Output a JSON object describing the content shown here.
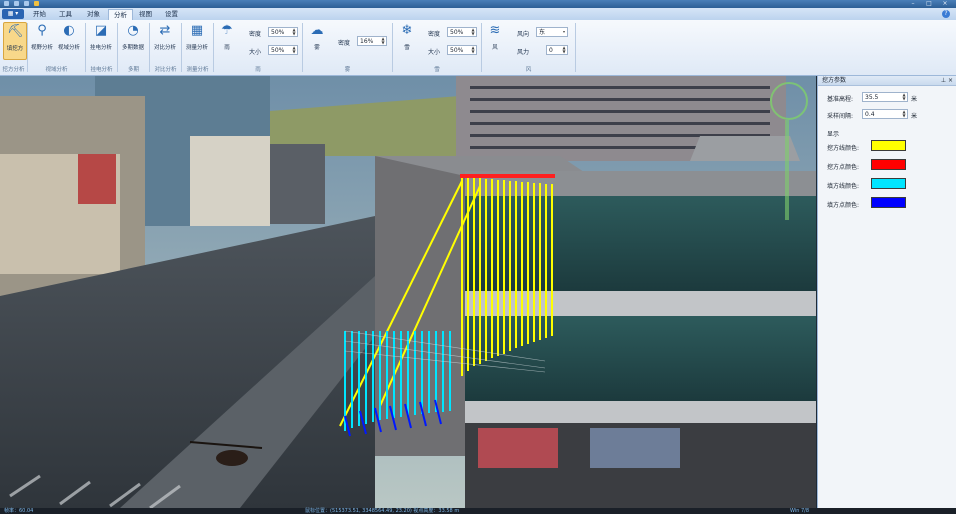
{
  "titlebar": {
    "title": ""
  },
  "tabs": [
    "开始",
    "工具",
    "对象",
    "分析",
    "视图",
    "设置"
  ],
  "active_tab": "分析",
  "ribbon": {
    "buttons": [
      {
        "label": "填挖方",
        "icon": "excavation-icon",
        "glyph": "⛏"
      },
      {
        "label": "视野分析",
        "icon": "view-analysis-icon",
        "glyph": "⚲"
      },
      {
        "label": "视域分析",
        "icon": "viewshed-icon",
        "glyph": "◐"
      },
      {
        "label": "挂电分析",
        "icon": "profile-analysis-icon",
        "glyph": "◪"
      },
      {
        "label": "多期数据",
        "icon": "multi-period-icon",
        "glyph": "◔"
      },
      {
        "label": "对比分析",
        "icon": "compare-icon",
        "glyph": "⇄"
      },
      {
        "label": "测量分析",
        "icon": "measure-icon",
        "glyph": "▦"
      },
      {
        "label": "雨",
        "icon": "rain-icon",
        "glyph": "☂"
      },
      {
        "label": "雾",
        "icon": "fog-icon",
        "glyph": "☁"
      },
      {
        "label": "雪",
        "icon": "snow-icon",
        "glyph": "❄"
      },
      {
        "label": "风",
        "icon": "wind-icon",
        "glyph": "≋"
      }
    ],
    "groups": [
      "挖方分析",
      "视域分析",
      "挂电分析",
      "多期",
      "对比分析",
      "测量分析",
      "雨",
      "雾",
      "雪",
      "风"
    ],
    "rain": {
      "density_label": "密度",
      "density_value": "50%",
      "size_label": "大小",
      "size_value": "50%"
    },
    "fog": {
      "density_label": "密度",
      "density_value": "16%"
    },
    "snow": {
      "density_label": "密度",
      "density_value": "50%",
      "size_label": "大小",
      "size_value": "50%"
    },
    "wind": {
      "direction_label": "风向",
      "direction_value": "东",
      "force_label": "风力",
      "force_value": "0"
    }
  },
  "panel": {
    "title": "挖方参数",
    "base_height_label": "基准高程:",
    "base_height_value": "35.5",
    "base_height_unit": "米",
    "sample_label": "采样间隔:",
    "sample_value": "0.4",
    "sample_unit": "米",
    "display_label": "显示",
    "colors": [
      {
        "label": "挖方线颜色:",
        "color": "#ffff00"
      },
      {
        "label": "挖方点颜色:",
        "color": "#ff0000"
      },
      {
        "label": "填方线颜色:",
        "color": "#00e5ff"
      },
      {
        "label": "填方点颜色:",
        "color": "#0000ff"
      }
    ]
  },
  "statusbar": {
    "left": "帧率：60.04",
    "center": "鼠标位置：(515373.51, 3348564.49, 23.20) 视点高度：33.58 m",
    "right": "Win 7/8"
  }
}
